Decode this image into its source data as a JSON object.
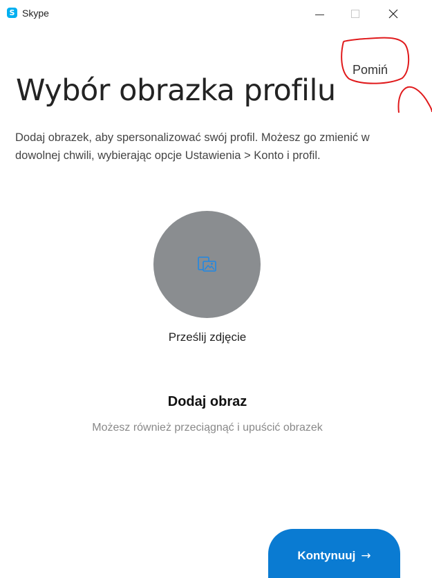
{
  "window": {
    "app_name": "Skype",
    "logo_letter": "S",
    "controls": [
      "minimize",
      "maximize",
      "close"
    ]
  },
  "header": {
    "skip_label": "Pomiń"
  },
  "main": {
    "title": "Wybór obrazka profilu",
    "description": "Dodaj obrazek, aby spersonalizować swój profil. Możesz go zmienić w dowolnej chwili, wybierając opcje Ustawienia > Konto i profil.",
    "avatar_icon": "image-upload-icon",
    "upload_label": "Prześlij zdjęcie",
    "add_image_heading": "Dodaj obraz",
    "drag_hint": "Możesz również przeciągnąć i upuścić obrazek"
  },
  "footer": {
    "continue_label": "Kontynuuj",
    "continue_arrow": "→"
  },
  "colors": {
    "accent": "#0a7bd2",
    "avatar_bg": "#8a8d90",
    "icon": "#1e88e5",
    "annotation": "#e0191b",
    "skype_logo": "#00aff0"
  }
}
